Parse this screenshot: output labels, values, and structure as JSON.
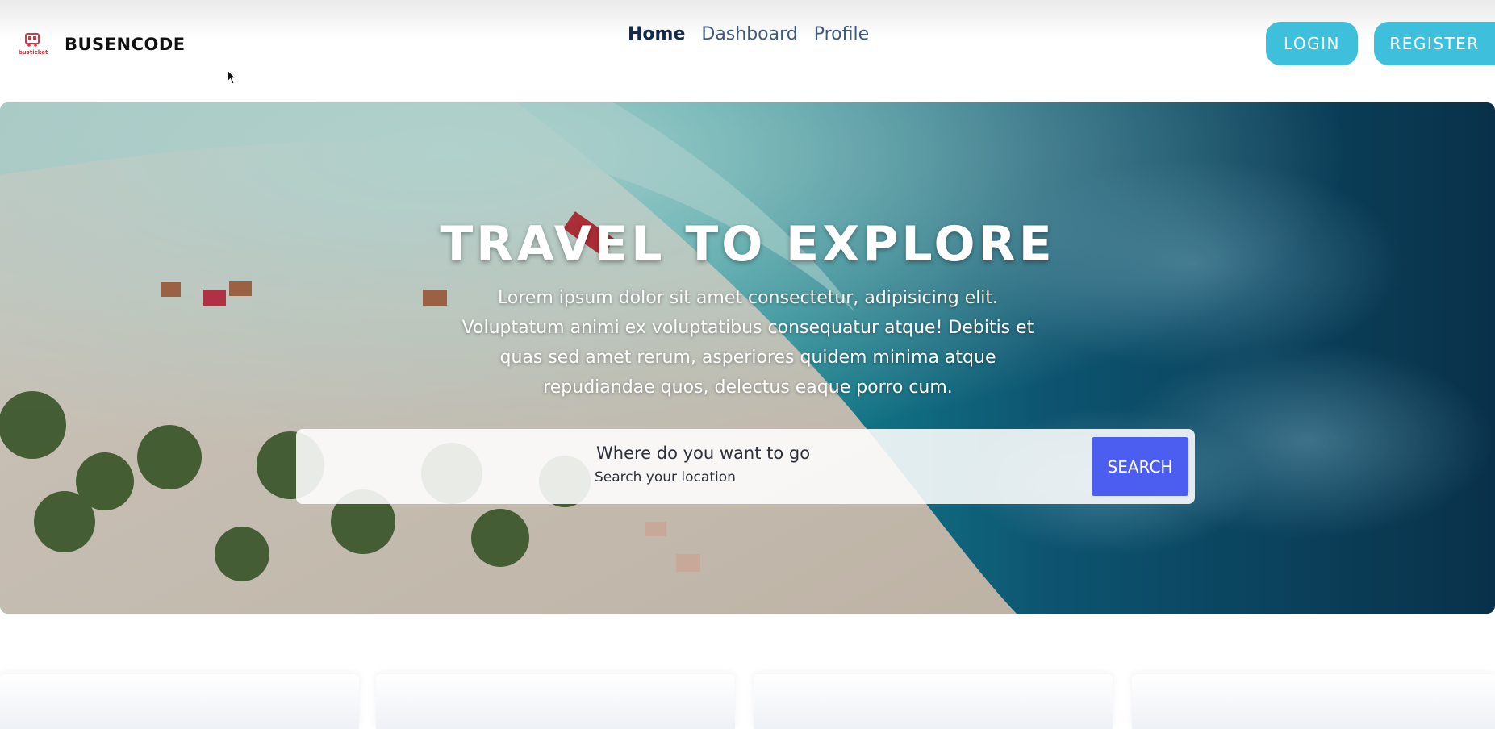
{
  "brand": {
    "name": "BUSENCODE",
    "logo_text": "busticket",
    "logo_color": "#e0303c"
  },
  "nav": {
    "links": [
      {
        "label": "Home",
        "active": true
      },
      {
        "label": "Dashboard",
        "active": false
      },
      {
        "label": "Profile",
        "active": false
      }
    ]
  },
  "auth": {
    "login_label": "LOGIN",
    "register_label": "REGISTER",
    "button_color": "#3ec0dc"
  },
  "hero": {
    "title": "TRAVEL TO EXPLORE",
    "text": "Lorem ipsum dolor sit amet consectetur, adipisicing elit. Voluptatum animi ex voluptatibus consequatur atque! Debitis et quas sed amet rerum, asperiores quidem minima atque repudiandae quos, delectus eaque porro cum."
  },
  "search": {
    "label": "Where do you want to go",
    "placeholder": "Search your location",
    "button_label": "SEARCH",
    "button_color": "#4c5ef0"
  },
  "cards": {
    "count_visible": 4
  }
}
